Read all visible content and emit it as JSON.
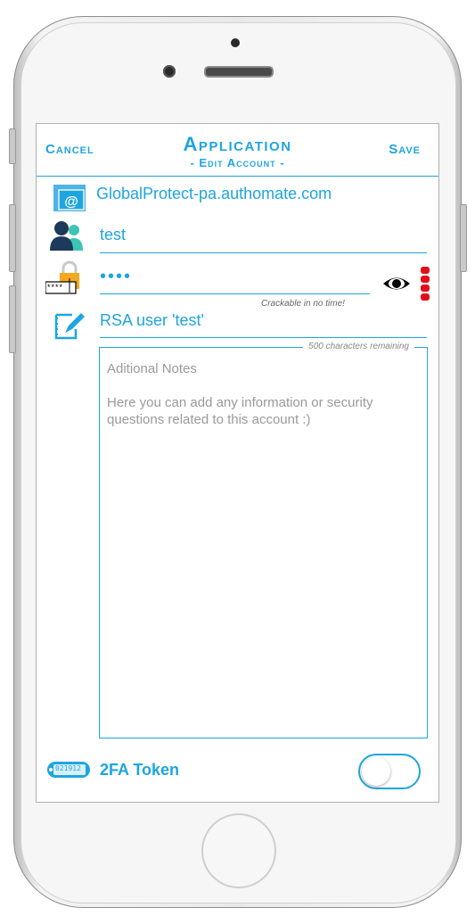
{
  "nav": {
    "cancel_label": "Cancel",
    "title": "Application",
    "subtitle": "- Edit Account -",
    "save_label": "Save"
  },
  "fields": {
    "url_value": "GlobalProtect-pa.authomate.com",
    "username_value": "test",
    "password_value": "••••",
    "password_strength_text": "Crackable in no time!",
    "notes_title_value": "RSA user 'test'",
    "chars_remaining_text": "500 characters remaining",
    "notes_placeholder_line1": "Aditional Notes",
    "notes_placeholder_line2": "Here you can add any information or security questions related to this account :)"
  },
  "password_icon_text": "****",
  "token": {
    "label": "2FA Token",
    "icon_text": "021912",
    "enabled": false
  },
  "icons": [
    "email-icon",
    "users-icon",
    "lock-password-icon",
    "eye-icon",
    "strength-meter-icon",
    "edit-note-icon",
    "token-icon"
  ],
  "colors": {
    "accent": "#1ea5e0",
    "strength_weak": "#e0101a"
  }
}
